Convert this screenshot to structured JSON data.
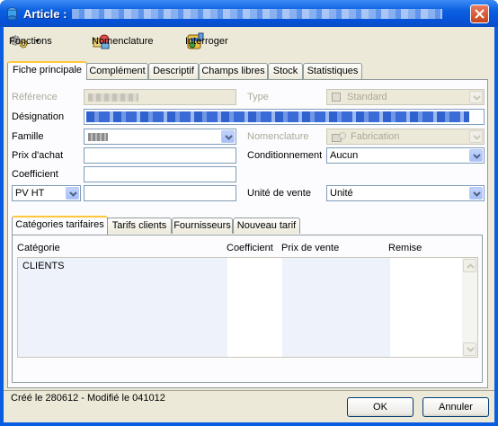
{
  "window": {
    "title": "Article :",
    "colors": {
      "titlebar": "#0b5fe0",
      "face": "#ece9d8",
      "tab_highlight": "#ffc83c",
      "blurred_text": "#3a6bd6"
    }
  },
  "toolbar": {
    "functions_label": "Fonctions",
    "functions_icon": "gears-icon",
    "nomenclature_label": "Nomenclature",
    "nomenclature_icon": "parts-icon",
    "interroger_label": "Interroger",
    "interroger_icon": "query-icon"
  },
  "tabs": [
    {
      "label": "Fiche principale",
      "active": true
    },
    {
      "label": "Complément"
    },
    {
      "label": "Descriptif"
    },
    {
      "label": "Champs libres"
    },
    {
      "label": "Stock"
    },
    {
      "label": "Statistiques"
    }
  ],
  "form": {
    "reference_label": "Référence",
    "designation_label": "Désignation",
    "famille_label": "Famille",
    "prix_achat_label": "Prix d'achat",
    "coefficient_label": "Coefficient",
    "pv_select_value": "PV HT",
    "type_label": "Type",
    "type_value": "Standard",
    "nomenclature_label": "Nomenclature",
    "nomenclature_value": "Fabrication",
    "conditionnement_label": "Conditionnement",
    "conditionnement_value": "Aucun",
    "unite_vente_label": "Unité de vente",
    "unite_vente_value": "Unité"
  },
  "subtabs": [
    {
      "label": "Catégories tarifaires",
      "active": true
    },
    {
      "label": "Tarifs clients"
    },
    {
      "label": "Fournisseurs"
    },
    {
      "label": "Nouveau tarif"
    }
  ],
  "grid": {
    "columns": [
      "Catégorie",
      "Coefficient",
      "Prix de vente",
      "Remise"
    ],
    "rows": [
      {
        "categorie": "CLIENTS",
        "coefficient": "",
        "prix_vente": "",
        "remise": ""
      }
    ]
  },
  "status": {
    "text": "Créé le 280612 - Modifié le 041012"
  },
  "buttons": {
    "ok_label": "OK",
    "annuler_label": "Annuler"
  }
}
